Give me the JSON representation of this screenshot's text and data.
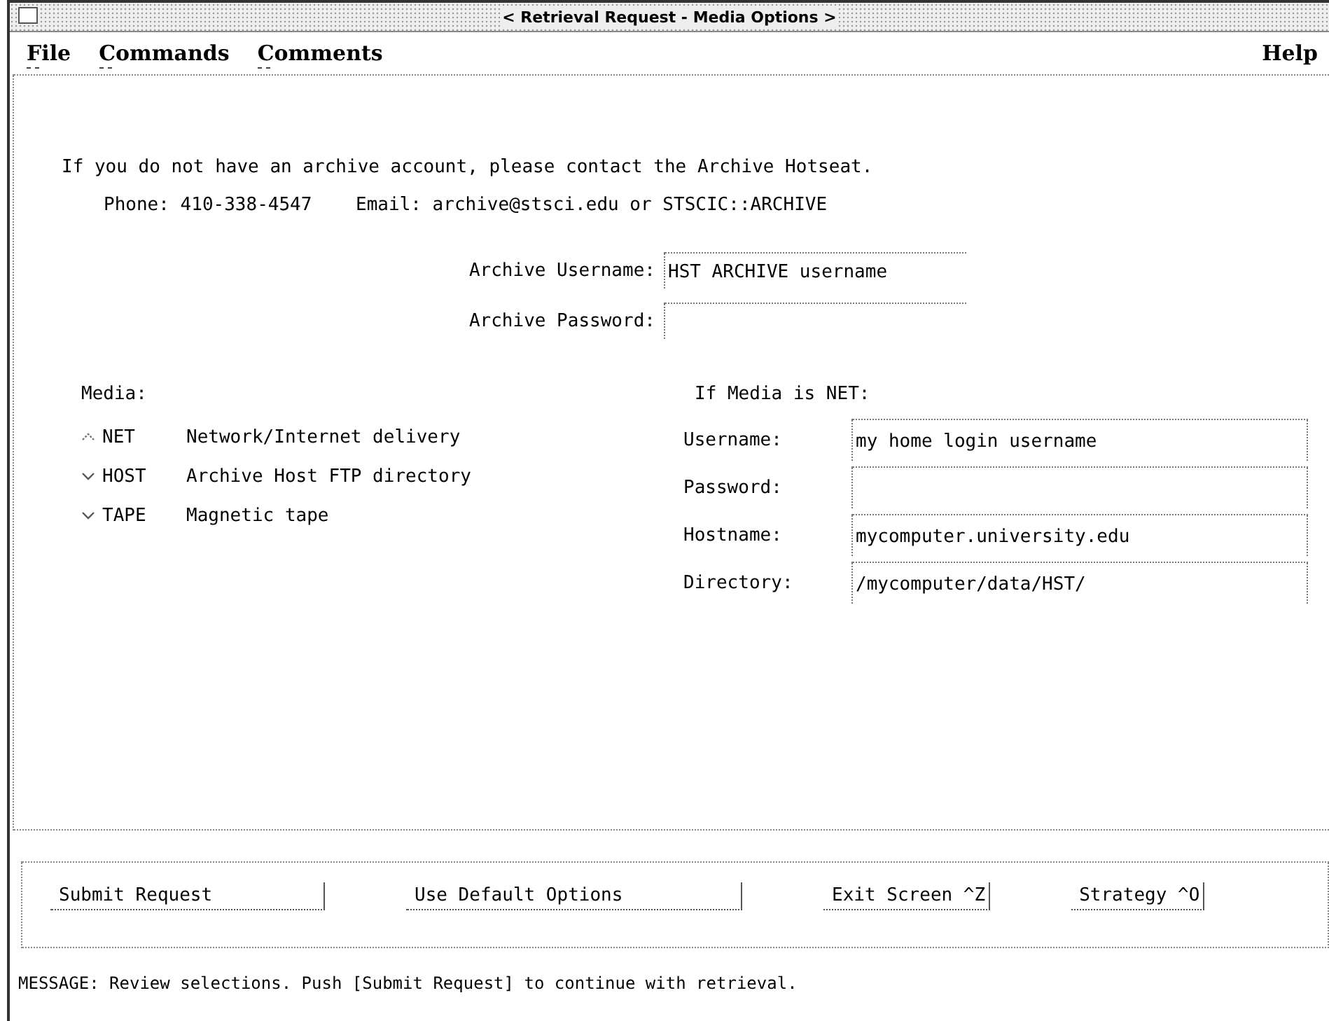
{
  "window": {
    "title": "< Retrieval Request - Media Options >"
  },
  "menu": {
    "items": [
      {
        "label": "File"
      },
      {
        "label": "Commands"
      },
      {
        "label": "Comments"
      }
    ],
    "help": "Help"
  },
  "notice": {
    "line": "If you do not have an archive account, please contact the Archive Hotseat.",
    "contact": "Phone: 410-338-4547    Email: archive@stsci.edu or STSCIC::ARCHIVE"
  },
  "account": [
    {
      "label": "Archive Username:",
      "value": "HST ARCHIVE username"
    },
    {
      "label": "Archive Password:"
    }
  ],
  "media": {
    "title": "Media:",
    "options": [
      {
        "code": "NET",
        "description": "Network/Internet delivery",
        "selected": true
      },
      {
        "code": "HOST",
        "description": "Archive Host FTP directory",
        "selected": false
      },
      {
        "code": "TAPE",
        "description": "Magnetic tape",
        "selected": false
      }
    ]
  },
  "net": {
    "title": "If Media is NET:",
    "fields": [
      {
        "label": "Username:",
        "value": "my home login username"
      },
      {
        "label": "Password:"
      },
      {
        "label": "Hostname:",
        "value": "mycomputer.university.edu"
      },
      {
        "label": "Directory:",
        "value": "/mycomputer/data/HST/"
      }
    ]
  },
  "buttons": [
    "Submit Request",
    "Use Default Options",
    "Exit Screen ^Z",
    "Strategy ^O"
  ],
  "message": "MESSAGE: Review selections. Push [Submit Request] to continue with retrieval."
}
